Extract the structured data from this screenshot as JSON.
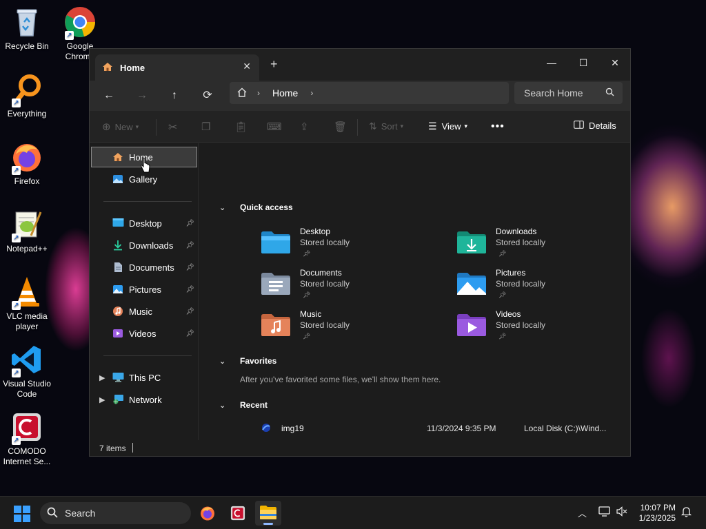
{
  "desktop": {
    "icons": [
      {
        "label": "Recycle Bin",
        "icon": "recycle-bin-icon"
      },
      {
        "label": "Google Chrome",
        "icon": "chrome-icon"
      },
      {
        "label": "Everything",
        "icon": "everything-icon"
      },
      {
        "label": "Firefox",
        "icon": "firefox-icon"
      },
      {
        "label": "Notepad++",
        "icon": "notepadpp-icon"
      },
      {
        "label": "VLC media player",
        "icon": "vlc-icon"
      },
      {
        "label": "Visual Studio Code",
        "icon": "vscode-icon"
      },
      {
        "label": "COMODO Internet Se...",
        "icon": "comodo-icon"
      }
    ]
  },
  "window": {
    "tab_title": "Home",
    "address": {
      "crumb": "Home"
    },
    "search_placeholder": "Search Home",
    "toolbar": {
      "new_label": "New",
      "sort_label": "Sort",
      "view_label": "View",
      "details_label": "Details"
    },
    "sidebar": {
      "top": [
        {
          "label": "Home",
          "icon": "home-icon",
          "selected": true
        },
        {
          "label": "Gallery",
          "icon": "gallery-icon"
        }
      ],
      "pinned": [
        {
          "label": "Desktop",
          "icon": "desktop-folder-icon"
        },
        {
          "label": "Downloads",
          "icon": "downloads-icon"
        },
        {
          "label": "Documents",
          "icon": "documents-icon"
        },
        {
          "label": "Pictures",
          "icon": "pictures-icon"
        },
        {
          "label": "Music",
          "icon": "music-icon"
        },
        {
          "label": "Videos",
          "icon": "videos-icon"
        }
      ],
      "drives": [
        {
          "label": "This PC",
          "icon": "this-pc-icon"
        },
        {
          "label": "Network",
          "icon": "network-icon"
        }
      ]
    },
    "content": {
      "quick_access_title": "Quick access",
      "quick_access": [
        {
          "name": "Desktop",
          "status": "Stored locally",
          "color": "#2fa7e8"
        },
        {
          "name": "Downloads",
          "status": "Stored locally",
          "color": "#1fb59a"
        },
        {
          "name": "Documents",
          "status": "Stored locally",
          "color": "#9aa8bb"
        },
        {
          "name": "Pictures",
          "status": "Stored locally",
          "color": "#2d9cf0"
        },
        {
          "name": "Music",
          "status": "Stored locally",
          "color": "#e5835a"
        },
        {
          "name": "Videos",
          "status": "Stored locally",
          "color": "#9a5ae0"
        }
      ],
      "favorites_title": "Favorites",
      "favorites_empty": "After you've favorited some files, we'll show them here.",
      "recent_title": "Recent",
      "recent": [
        {
          "name": "img19",
          "date": "11/3/2024 9:35 PM",
          "location": "Local Disk (C:)\\Wind..."
        }
      ]
    },
    "status": {
      "items": "7 items"
    }
  },
  "taskbar": {
    "search_label": "Search",
    "time": "10:07 PM",
    "date": "1/23/2025"
  }
}
